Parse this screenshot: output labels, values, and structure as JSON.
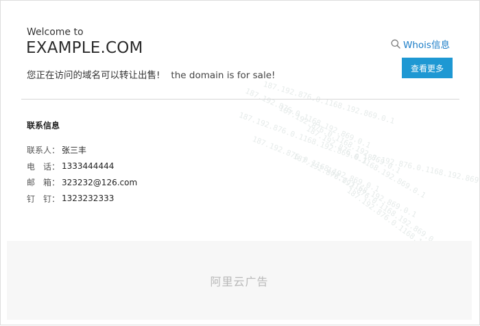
{
  "header": {
    "welcome": "Welcome to",
    "domain": "EXAMPLE.COM",
    "sale_cn": "您正在访问的域名可以转让出售!",
    "sale_en": "the domain is for sale!"
  },
  "actions": {
    "whois_label": "Whois信息",
    "more_button": "查看更多"
  },
  "contact": {
    "title": "联系信息",
    "rows": [
      {
        "label": "联系人：",
        "value": "张三丰"
      },
      {
        "label": "电　话：",
        "value": "1333444444"
      },
      {
        "label": "邮　箱：",
        "value": "323232@126.com"
      },
      {
        "label": "钉　钉：",
        "value": "1323232333"
      }
    ]
  },
  "ad": {
    "label": "阿里云广告"
  },
  "watermark_text": "187.192.876.0.1168.192.869.0.1",
  "colors": {
    "accent": "#1e98d3",
    "link": "#1a7cc7"
  },
  "icons": {
    "whois": "search-icon"
  }
}
